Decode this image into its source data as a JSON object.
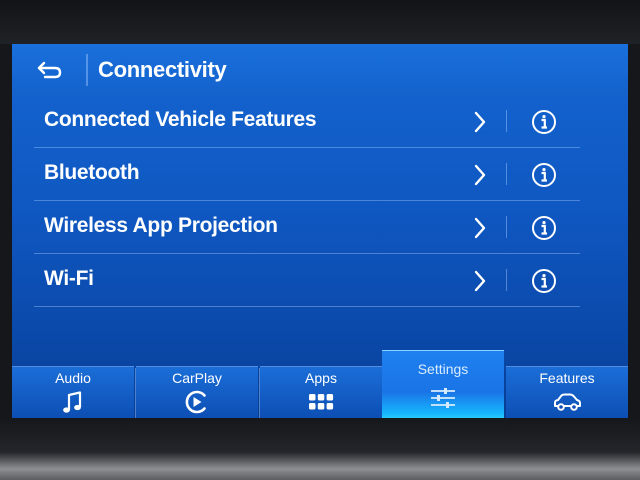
{
  "header": {
    "title": "Connectivity",
    "back_icon": "back-arrow-icon"
  },
  "menu": {
    "items": [
      {
        "label": "Connected Vehicle Features"
      },
      {
        "label": "Bluetooth"
      },
      {
        "label": "Wireless App Projection"
      },
      {
        "label": "Wi-Fi"
      }
    ]
  },
  "tabs": [
    {
      "label": "Audio",
      "icon": "music-note-icon",
      "active": false
    },
    {
      "label": "CarPlay",
      "icon": "carplay-icon",
      "active": false
    },
    {
      "label": "Apps",
      "icon": "apps-grid-icon",
      "active": false
    },
    {
      "label": "Settings",
      "icon": "settings-sliders-icon",
      "active": true
    },
    {
      "label": "Features",
      "icon": "car-icon",
      "active": false
    }
  ],
  "colors": {
    "screen_blue": "#1566d2",
    "active_tab_glow": "#2fd0ff",
    "text": "#ffffff"
  }
}
